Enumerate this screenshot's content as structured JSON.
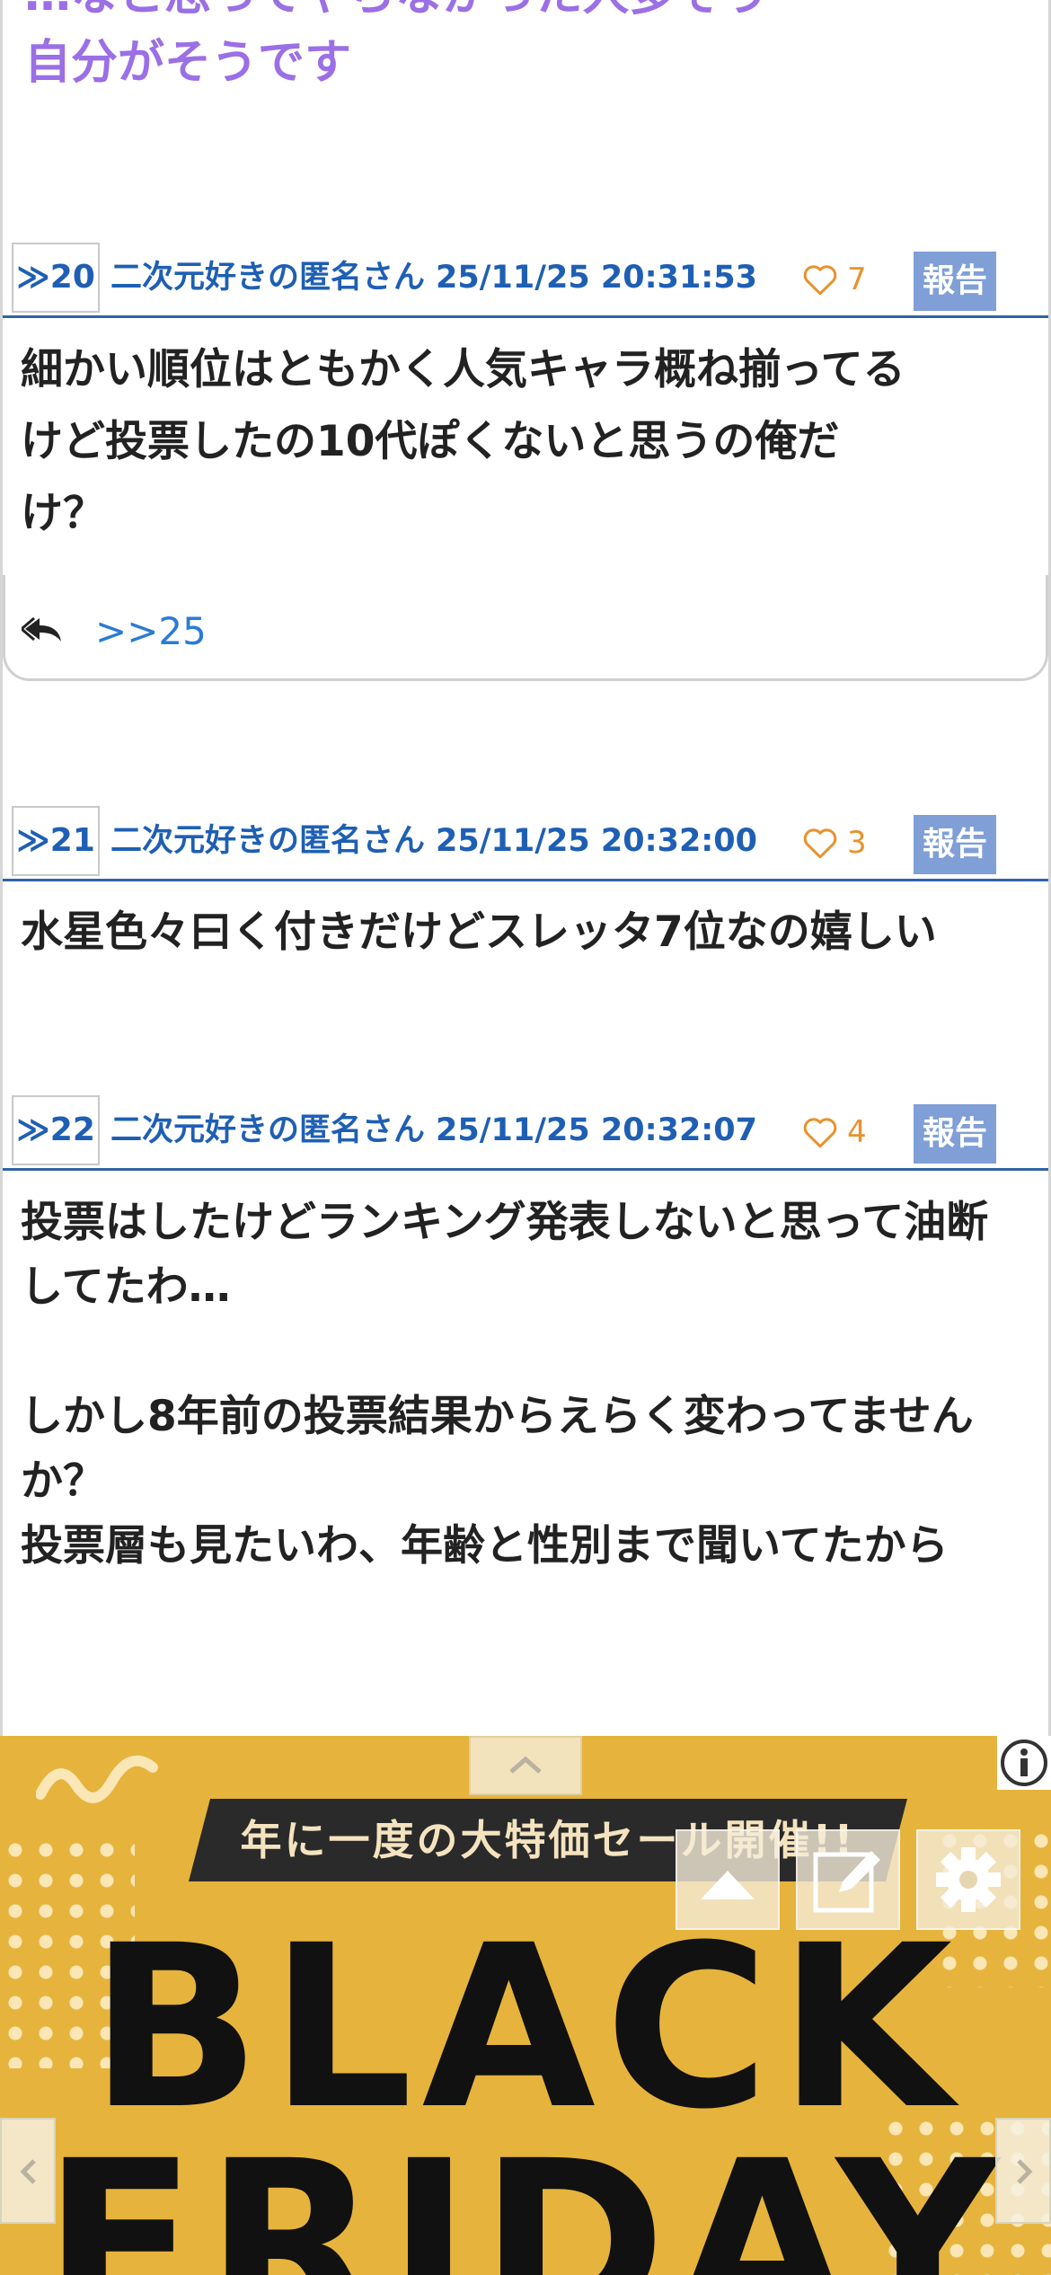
{
  "previous_post": {
    "quote_line_1": "…なと思ってやらなかった人多そう",
    "quote_line_2": "自分がそうです"
  },
  "posts": [
    {
      "number": "≫20",
      "author": "二次元好きの匿名さん",
      "datetime": "25/11/25 20:31:53",
      "likes": "7",
      "report": "報告",
      "lines": [
        "細かい順位はともかく人気キャラ概ね揃ってる",
        "けど投票したの10代ぽくないと思うの俺だ",
        "け？"
      ],
      "reply_link": ">>25"
    },
    {
      "number": "≫21",
      "author": "二次元好きの匿名さん",
      "datetime": "25/11/25 20:32:00",
      "likes": "3",
      "report": "報告",
      "lines": [
        "水星色々曰く付きだけどスレッタ7位なの嬉しい"
      ]
    },
    {
      "number": "≫22",
      "author": "二次元好きの匿名さん",
      "datetime": "25/11/25 20:32:07",
      "likes": "4",
      "report": "報告",
      "lines": [
        "投票はしたけどランキング発表しないと思って油断",
        "してたわ…",
        "",
        "しかし8年前の投票結果からえらく変わってません",
        "か？",
        "投票層も見たいわ、年齢と性別まで聞いてたから"
      ]
    }
  ],
  "ad": {
    "headline": "年に一度の大特価セール開催!!",
    "title_line_1": "BLACK",
    "title_line_2": "FRIDAY"
  },
  "colors": {
    "link_blue": "#1e5fb4",
    "quote_purple": "#9b6fe6",
    "like_orange": "#e8922d",
    "report_bg": "#7f9fd6",
    "ad_yellow": "#e6b43c"
  }
}
